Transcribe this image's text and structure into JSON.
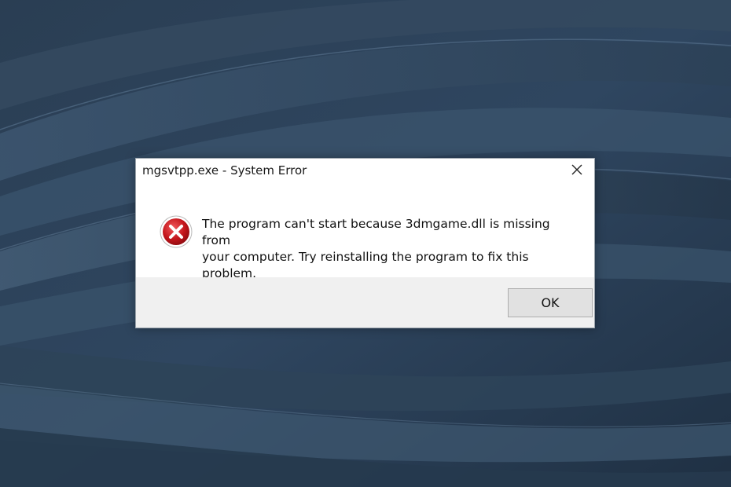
{
  "desktop": {
    "background_color": "#2c4157"
  },
  "dialog": {
    "title": "mgsvtpp.exe - System Error",
    "close_icon": "close-icon",
    "icon": "error-icon",
    "message_line1": "The program can't start because 3dmgame.dll is missing from",
    "message_line2": "your computer. Try reinstalling the program to fix this problem.",
    "ok_label": "OK",
    "icon_color": "#c4161c"
  }
}
